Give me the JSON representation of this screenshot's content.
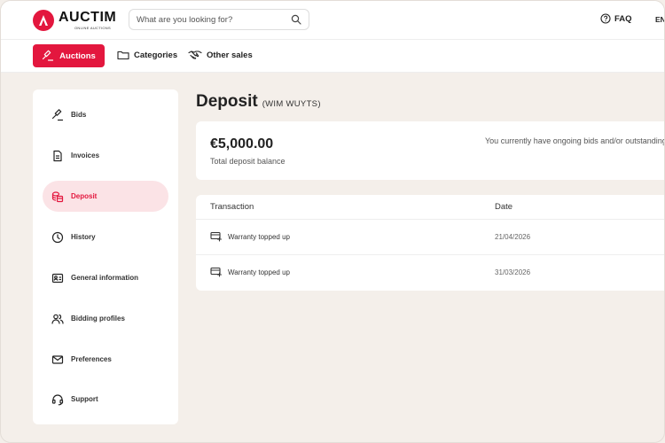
{
  "header": {
    "brand": "AUCTIM",
    "brand_sub": "ONLINE AUCTIONS",
    "search_placeholder": "What are you looking for?",
    "faq_label": "FAQ",
    "language": "EN"
  },
  "nav": {
    "auctions": "Auctions",
    "categories": "Categories",
    "other_sales": "Other sales"
  },
  "sidebar": {
    "items": [
      {
        "label": "Bids",
        "icon": "gavel-icon"
      },
      {
        "label": "Invoices",
        "icon": "invoice-icon"
      },
      {
        "label": "Deposit",
        "icon": "coins-icon",
        "active": true
      },
      {
        "label": "History",
        "icon": "clock-icon"
      },
      {
        "label": "General information",
        "icon": "id-card-icon"
      },
      {
        "label": "Bidding profiles",
        "icon": "users-icon"
      },
      {
        "label": "Preferences",
        "icon": "mail-icon"
      },
      {
        "label": "Support",
        "icon": "headset-icon"
      }
    ]
  },
  "page": {
    "title": "Deposit",
    "subtitle": "(WIM WUYTS)"
  },
  "balance": {
    "amount": "€5,000.00",
    "label": "Total deposit balance",
    "notice": "You currently have ongoing bids and/or outstanding"
  },
  "transactions": {
    "headers": {
      "transaction": "Transaction",
      "date": "Date"
    },
    "rows": [
      {
        "name": "Warranty topped up",
        "date": "21/04/2026"
      },
      {
        "name": "Warranty topped up",
        "date": "31/03/2026"
      }
    ]
  },
  "colors": {
    "accent": "#e3173e",
    "accent_soft": "#fbe3e6",
    "page_bg": "#f4efea"
  }
}
